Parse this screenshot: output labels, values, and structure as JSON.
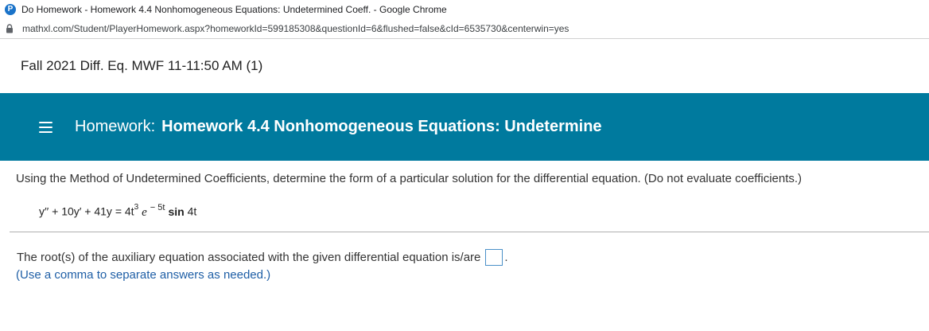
{
  "browser": {
    "window_title": "Do Homework - Homework 4.4 Nonhomogeneous Equations: Undetermined Coeff. - Google Chrome",
    "url": "mathxl.com/Student/PlayerHomework.aspx?homeworkId=599185308&questionId=6&flushed=false&cId=6535730&centerwin=yes",
    "favicon_letter": "P"
  },
  "course": {
    "title": "Fall 2021 Diff. Eq. MWF 11-11:50 AM (1)"
  },
  "homework": {
    "label": "Homework:",
    "name": "Homework 4.4 Nonhomogeneous Equations: Undetermine"
  },
  "question": {
    "instructions": "Using the Method of Undetermined Coefficients, determine the form of a particular solution for the differential equation. (Do not evaluate coefficients.)",
    "equation": {
      "lhs": "y′′ + 10y′ + 41y = 4t",
      "t_power": "3",
      "e": "e",
      "e_power": "− 5t",
      "sin": "sin",
      "sin_arg": " 4t"
    },
    "prompt": "The root(s) of the auxiliary equation associated with the given differential equation is/are",
    "answer_value": "",
    "period": ".",
    "hint": "(Use a comma to separate answers as needed.)"
  },
  "colors": {
    "banner": "#007a9e",
    "hint_text": "#1f5fa6",
    "input_border": "#4a90c8"
  }
}
